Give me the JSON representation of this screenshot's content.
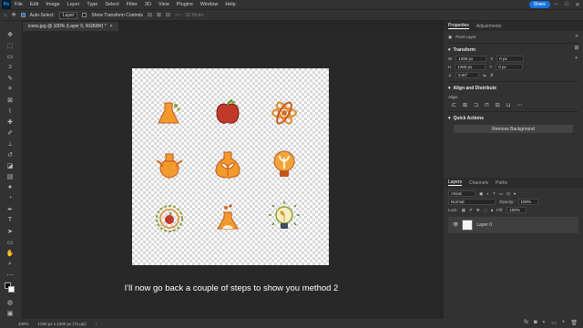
{
  "menu": {
    "logo": "Ps",
    "items": [
      "File",
      "Edit",
      "Image",
      "Layer",
      "Type",
      "Select",
      "Filter",
      "3D",
      "View",
      "Plugins",
      "Window",
      "Help"
    ],
    "share_label": "Share"
  },
  "options": {
    "auto_select_label": "Auto-Select:",
    "auto_select_value": "Layer",
    "transform_controls_label": "Show Transform Controls",
    "mode_3d_label": "3D Mode:"
  },
  "document": {
    "tab_label": "icons.jpg @ 100% (Layer 0, RGB/8#) *",
    "close_glyph": "×"
  },
  "subtitle": "I'll now go back a couple of steps to show you method 2",
  "status": {
    "zoom": "100%",
    "dims": "1280 px x 1280 px (72 ppi)",
    "arrow": "›"
  },
  "properties": {
    "tab_properties": "Properties",
    "tab_adjustments": "Adjustments",
    "pixel_layer_label": "Pixel Layer",
    "transform_header": "Transform",
    "w_label": "W",
    "w_value": "1280 px",
    "h_label": "H",
    "h_value": "1280 px",
    "x_label": "X",
    "x_value": "0 px",
    "y_label": "Y",
    "y_value": "0 px",
    "angle_value": "0.00°",
    "align_header": "Align and Distribute",
    "align_label": "Align:",
    "quick_actions_header": "Quick Actions",
    "remove_bg_label": "Remove Background"
  },
  "layers": {
    "tab_layers": "Layers",
    "tab_channels": "Channels",
    "tab_paths": "Paths",
    "kind_label": "Kind",
    "blend_mode": "Normal",
    "opacity_label": "Opacity:",
    "opacity_value": "100%",
    "lock_label": "Lock:",
    "fill_label": "Fill:",
    "fill_value": "100%",
    "layer_name": "Layer 0"
  }
}
